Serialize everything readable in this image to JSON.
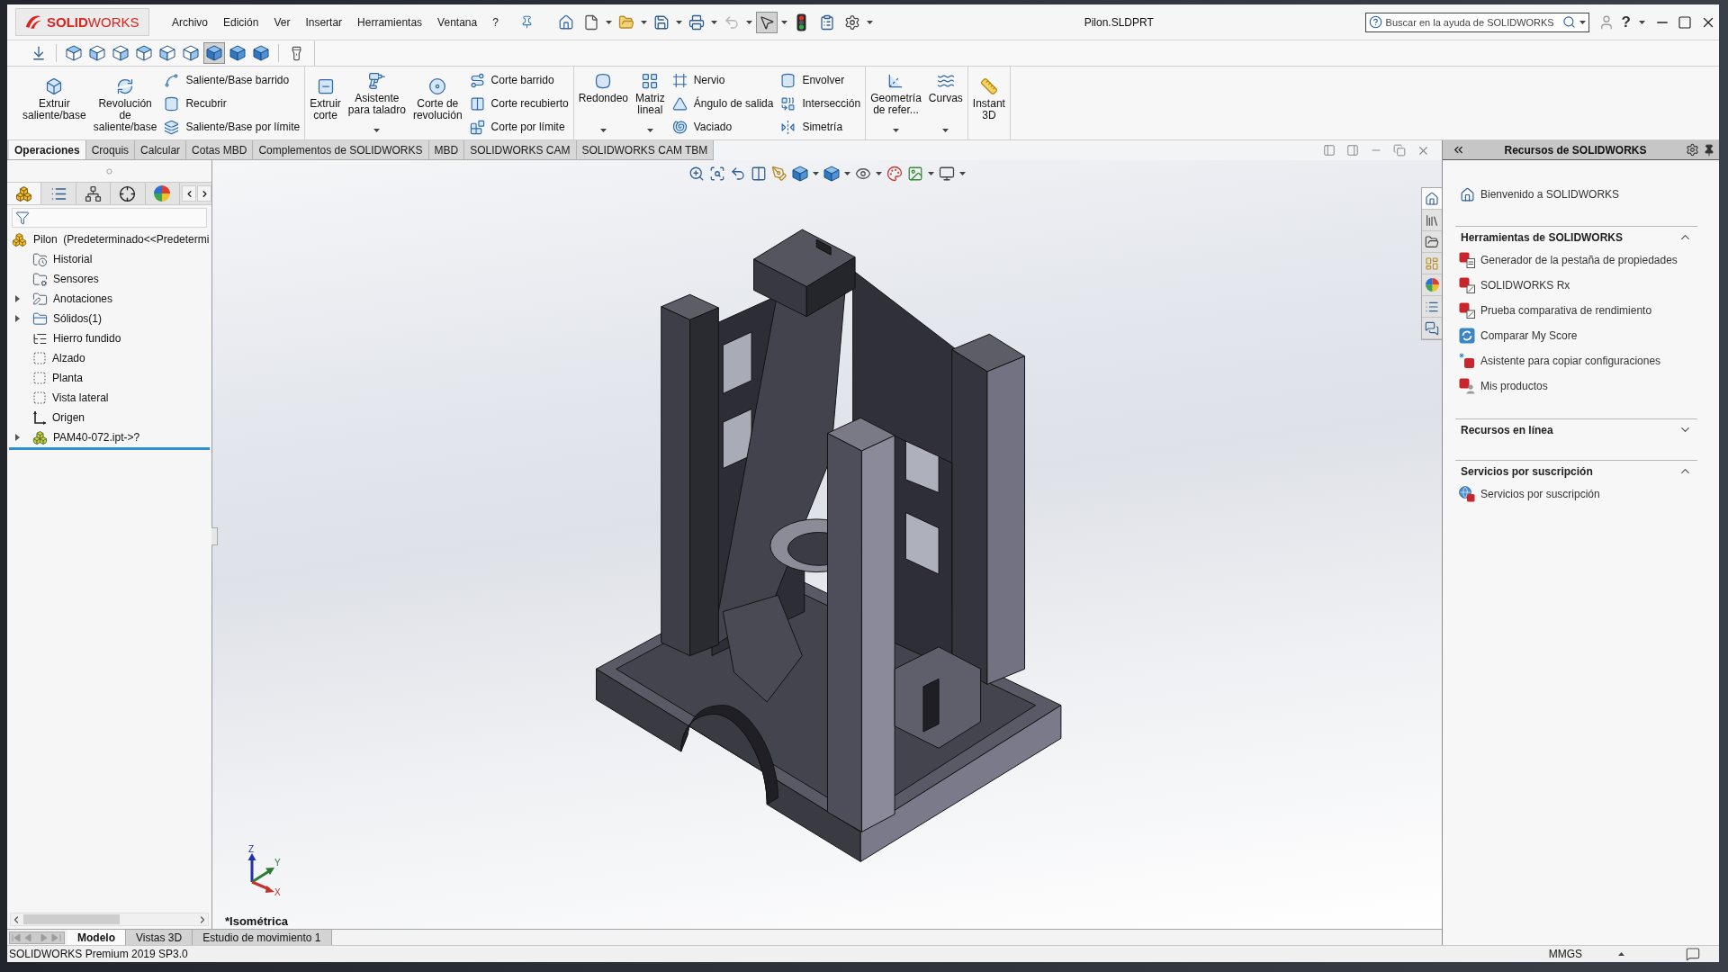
{
  "window": {
    "logo": "**SOLID**WORKS",
    "title": "Pilon.SLDPRT",
    "help": "?"
  },
  "menu": [
    "Archivo",
    "Edición",
    "Ver",
    "Insertar",
    "Herramientas",
    "Ventana",
    "?"
  ],
  "quick_tools": [
    {
      "dropdown": false,
      "pressed": false,
      "disabled": false
    },
    {
      "dropdown": true,
      "pressed": false,
      "disabled": false
    },
    {
      "dropdown": true,
      "pressed": false,
      "disabled": false
    },
    {
      "dropdown": true,
      "pressed": false,
      "disabled": false
    },
    {
      "dropdown": true,
      "pressed": false,
      "disabled": false
    },
    {
      "dropdown": true,
      "pressed": false,
      "disabled": true
    },
    {
      "dropdown": true,
      "pressed": true,
      "disabled": false
    },
    {
      "dropdown": false,
      "pressed": false,
      "disabled": false
    },
    {
      "dropdown": false,
      "pressed": false,
      "disabled": false
    },
    {
      "dropdown": true,
      "pressed": false,
      "disabled": false
    }
  ],
  "search": {
    "placeholder": "Buscar en la ayuda de SOLIDWORKS"
  },
  "view_toolbar": [
    {
      "selected": false
    },
    {
      "selected": false
    },
    {
      "selected": false
    },
    {
      "selected": false
    },
    {
      "selected": false
    },
    {
      "selected": false
    },
    {
      "selected": true
    },
    {
      "selected": false
    },
    {
      "selected": false
    }
  ],
  "ribbon": {
    "groups": [
      {
        "buttons": [
          {
            "kind": "large",
            "lines": [
              "Extruir",
              "saliente/base"
            ],
            "dropdown": false
          },
          {
            "kind": "large",
            "lines": [
              "Revolución",
              "de",
              "saliente/base"
            ],
            "dropdown": false
          },
          {
            "kind": "stack",
            "items": [
              "Saliente/Base barrido",
              "Recubrir",
              "Saliente/Base por límite"
            ]
          }
        ]
      },
      {
        "buttons": [
          {
            "kind": "large",
            "lines": [
              "Extruir",
              "corte"
            ],
            "dropdown": false
          },
          {
            "kind": "large",
            "lines": [
              "Asistente",
              "para taladro"
            ],
            "dropdown": true
          },
          {
            "kind": "large",
            "lines": [
              "Corte de",
              "revolución"
            ],
            "dropdown": false
          },
          {
            "kind": "stack",
            "items": [
              "Corte barrido",
              "Corte recubierto",
              "Corte por límite"
            ]
          }
        ]
      },
      {
        "buttons": [
          {
            "kind": "large",
            "lines": [
              "Redondeo"
            ],
            "dropdown": true
          },
          {
            "kind": "large",
            "lines": [
              "Matriz",
              "lineal"
            ],
            "dropdown": true
          },
          {
            "kind": "stack",
            "items": [
              "Nervio",
              "Ángulo de salida",
              "Vaciado"
            ]
          },
          {
            "kind": "stack",
            "items": [
              "Envolver",
              "Intersección",
              "Simetría"
            ]
          }
        ]
      },
      {
        "buttons": [
          {
            "kind": "large",
            "lines": [
              "Geometría",
              "de refer..."
            ],
            "dropdown": true
          },
          {
            "kind": "large",
            "lines": [
              "Curvas"
            ],
            "dropdown": true
          }
        ]
      },
      {
        "buttons": [
          {
            "kind": "large",
            "lines": [
              "Instant",
              "3D"
            ],
            "dropdown": false
          }
        ]
      }
    ]
  },
  "command_tabs": [
    {
      "label": "Operaciones",
      "selected": true
    },
    {
      "label": "Croquis",
      "selected": false
    },
    {
      "label": "Calcular",
      "selected": false
    },
    {
      "label": "Cotas MBD",
      "selected": false
    },
    {
      "label": "Complementos de SOLIDWORKS",
      "selected": false
    },
    {
      "label": "MBD",
      "selected": false
    },
    {
      "label": "SOLIDWORKS CAM",
      "selected": false
    },
    {
      "label": "SOLIDWORKS CAM TBM",
      "selected": false
    }
  ],
  "feature_manager": {
    "tabs": [
      {
        "selected": true
      },
      {
        "selected": false
      },
      {
        "selected": false
      },
      {
        "selected": false
      },
      {
        "selected": false
      }
    ],
    "tree": {
      "label": "Pilon  (Predeterminado<<Predetermi",
      "kind": "part",
      "children": [
        {
          "label": "Historial",
          "kind": "history",
          "collapsed": false
        },
        {
          "label": "Sensores",
          "kind": "sensors",
          "collapsed": false
        },
        {
          "label": "Anotaciones",
          "kind": "annotations",
          "collapsed": true
        },
        {
          "label": "Sólidos(1)",
          "kind": "bodies",
          "collapsed": true
        },
        {
          "label": "Hierro fundido",
          "kind": "cutlist",
          "collapsed": false
        },
        {
          "label": "Alzado",
          "kind": "plane",
          "collapsed": false
        },
        {
          "label": "Planta",
          "kind": "plane",
          "collapsed": false
        },
        {
          "label": "Vista lateral",
          "kind": "plane",
          "collapsed": false
        },
        {
          "label": "Origen",
          "kind": "origin",
          "collapsed": false
        },
        {
          "label": "PAM40-072.ipt->?",
          "kind": "import",
          "collapsed": true
        }
      ]
    }
  },
  "viewport": {
    "view_name": "*Isométrica",
    "triad_labels": [
      "Z",
      "Y",
      "X"
    ]
  },
  "task_pane": {
    "title": "Recursos de SOLIDWORKS",
    "tabs": [
      {
        "selected": true
      },
      {
        "selected": false
      },
      {
        "selected": false
      },
      {
        "selected": false
      },
      {
        "selected": false
      },
      {
        "selected": false
      },
      {
        "selected": false
      }
    ],
    "welcome": "Bienvenido a SOLIDWORKS",
    "sections": [
      {
        "title": "Herramientas de SOLIDWORKS",
        "expanded": true,
        "items": [
          "Generador de la pestaña de propiedades",
          "SOLIDWORKS Rx",
          "Prueba comparativa de rendimiento",
          "Comparar My Score",
          "Asistente para copiar configuraciones",
          "Mis productos"
        ]
      },
      {
        "title": "Recursos en línea",
        "expanded": false
      },
      {
        "title": "Servicios por suscripción",
        "expanded": true,
        "items": [
          "Servicios por suscripción"
        ]
      }
    ]
  },
  "bottom_tabs": [
    {
      "label": "Modelo",
      "selected": true
    },
    {
      "label": "Vistas 3D",
      "selected": false
    },
    {
      "label": "Estudio de movimiento 1",
      "selected": false
    }
  ],
  "status_bar": {
    "product": "SOLIDWORKS Premium 2019 SP3.0",
    "units": "MMGS"
  }
}
